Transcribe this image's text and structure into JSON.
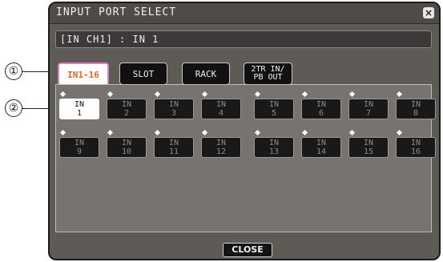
{
  "callouts": [
    "①",
    "②"
  ],
  "window": {
    "title": "INPUT PORT SELECT",
    "close_glyph": "×"
  },
  "channel_field": "[IN CH1] : IN 1",
  "tabs": [
    {
      "label": "IN1-16",
      "active": true
    },
    {
      "label": "SLOT",
      "active": false
    },
    {
      "label": "RACK",
      "active": false
    },
    {
      "line1": "2TR IN/",
      "line2": "PB OUT",
      "active": false
    }
  ],
  "ports": [
    {
      "prefix": "IN",
      "num": "1",
      "selected": true
    },
    {
      "prefix": "IN",
      "num": "2"
    },
    {
      "prefix": "IN",
      "num": "3"
    },
    {
      "prefix": "IN",
      "num": "4"
    },
    {
      "prefix": "IN",
      "num": "5"
    },
    {
      "prefix": "IN",
      "num": "6"
    },
    {
      "prefix": "IN",
      "num": "7"
    },
    {
      "prefix": "IN",
      "num": "8"
    },
    {
      "prefix": "IN",
      "num": "9"
    },
    {
      "prefix": "IN",
      "num": "10"
    },
    {
      "prefix": "IN",
      "num": "11"
    },
    {
      "prefix": "IN",
      "num": "12"
    },
    {
      "prefix": "IN",
      "num": "13"
    },
    {
      "prefix": "IN",
      "num": "14"
    },
    {
      "prefix": "IN",
      "num": "15"
    },
    {
      "prefix": "IN",
      "num": "16"
    }
  ],
  "close_button": "CLOSE",
  "colors": {
    "active_tab_text": "#e8602c",
    "active_tab_border": "#d680c8"
  }
}
